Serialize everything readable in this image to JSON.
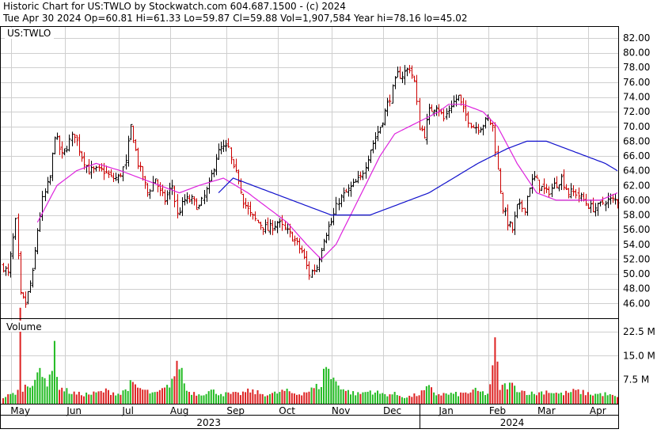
{
  "header": {
    "line1": "Historic Chart for US:TWLO by Stockwatch.com 604.687.1500 - (c) 2024",
    "line2": "Tue Apr 30 2024   Op=60.81   Hi=61.33   Lo=59.87   Cl=59.88   Vol=1,907,584   Year hi=78.16   lo=45.02"
  },
  "chart_data": {
    "type": "ohlc",
    "symbol_label": "US:TWLO",
    "volume_label": "Volume",
    "price_axis": {
      "ylim": [
        44.0,
        83.5
      ],
      "ticks": [
        46,
        48,
        50,
        52,
        54,
        56,
        58,
        60,
        62,
        64,
        66,
        68,
        70,
        72,
        74,
        76,
        78,
        80,
        82
      ],
      "tick_labels": [
        "46.00",
        "48.00",
        "50.00",
        "52.00",
        "54.00",
        "56.00",
        "58.00",
        "60.00",
        "62.00",
        "64.00",
        "66.00",
        "68.00",
        "70.00",
        "72.00",
        "74.00",
        "76.00",
        "78.00",
        "80.00",
        "82.00"
      ]
    },
    "volume_axis": {
      "ylim": [
        0,
        26.5
      ],
      "ticks": [
        7.5,
        15.0,
        22.5
      ],
      "tick_labels": [
        "7.5 M",
        "15.0 M",
        "22.5 M"
      ]
    },
    "x_axis": {
      "months": [
        {
          "label": "May",
          "index": 7
        },
        {
          "label": "Jun",
          "index": 29
        },
        {
          "label": "Jul",
          "index": 51
        },
        {
          "label": "Aug",
          "index": 72
        },
        {
          "label": "Sep",
          "index": 95
        },
        {
          "label": "Oct",
          "index": 116
        },
        {
          "label": "Nov",
          "index": 138
        },
        {
          "label": "Dec",
          "index": 159
        },
        {
          "label": "Jan",
          "index": 181
        },
        {
          "label": "Feb",
          "index": 202
        },
        {
          "label": "Mar",
          "index": 222
        },
        {
          "label": "Apr",
          "index": 243
        }
      ],
      "years": [
        {
          "label": "2023",
          "index": 84
        },
        {
          "label": "2024",
          "index": 208
        }
      ],
      "year_divider_index": 170
    },
    "price_keypoints": [
      [
        0,
        51
      ],
      [
        2,
        50
      ],
      [
        5,
        57
      ],
      [
        7,
        47
      ],
      [
        9,
        46
      ],
      [
        12,
        50
      ],
      [
        14,
        56
      ],
      [
        16,
        60
      ],
      [
        19,
        63
      ],
      [
        21,
        69
      ],
      [
        24,
        66
      ],
      [
        27,
        68
      ],
      [
        29,
        69
      ],
      [
        32,
        66
      ],
      [
        35,
        64
      ],
      [
        38,
        64
      ],
      [
        41,
        64
      ],
      [
        44,
        63
      ],
      [
        47,
        63
      ],
      [
        50,
        65
      ],
      [
        52,
        70
      ],
      [
        55,
        65
      ],
      [
        57,
        63
      ],
      [
        59,
        61
      ],
      [
        62,
        63
      ],
      [
        64,
        61
      ],
      [
        66,
        60
      ],
      [
        69,
        62
      ],
      [
        71,
        58
      ],
      [
        74,
        60
      ],
      [
        77,
        60
      ],
      [
        80,
        59
      ],
      [
        84,
        62
      ],
      [
        87,
        66
      ],
      [
        89,
        67
      ],
      [
        92,
        67
      ],
      [
        94,
        64
      ],
      [
        96,
        63
      ],
      [
        98,
        60
      ],
      [
        101,
        58
      ],
      [
        104,
        57
      ],
      [
        108,
        56
      ],
      [
        112,
        57
      ],
      [
        115,
        56
      ],
      [
        118,
        55
      ],
      [
        122,
        53
      ],
      [
        125,
        50
      ],
      [
        128,
        51
      ],
      [
        131,
        55
      ],
      [
        134,
        57
      ],
      [
        137,
        60
      ],
      [
        140,
        61
      ],
      [
        143,
        62
      ],
      [
        146,
        63
      ],
      [
        150,
        67
      ],
      [
        154,
        70
      ],
      [
        158,
        74
      ],
      [
        161,
        77
      ],
      [
        163,
        77
      ],
      [
        166,
        78
      ],
      [
        168,
        76
      ],
      [
        170,
        70
      ],
      [
        172,
        69
      ],
      [
        174,
        72
      ],
      [
        177,
        73
      ],
      [
        180,
        71
      ],
      [
        183,
        73
      ],
      [
        186,
        74
      ],
      [
        188,
        72
      ],
      [
        190,
        71
      ],
      [
        192,
        70
      ],
      [
        195,
        70
      ],
      [
        198,
        71
      ],
      [
        200,
        70
      ],
      [
        202,
        64
      ],
      [
        204,
        59
      ],
      [
        206,
        57
      ],
      [
        208,
        56
      ],
      [
        210,
        59
      ],
      [
        213,
        59
      ],
      [
        215,
        62
      ],
      [
        217,
        63
      ],
      [
        219,
        62
      ],
      [
        222,
        61
      ],
      [
        225,
        62
      ],
      [
        228,
        63
      ],
      [
        231,
        61
      ],
      [
        234,
        61
      ],
      [
        237,
        60
      ],
      [
        240,
        59
      ],
      [
        243,
        59
      ],
      [
        246,
        60
      ],
      [
        249,
        60
      ],
      [
        251,
        60
      ]
    ],
    "ma_short": [
      [
        14,
        57
      ],
      [
        22,
        62
      ],
      [
        30,
        64
      ],
      [
        38,
        65
      ],
      [
        48,
        64
      ],
      [
        56,
        63
      ],
      [
        64,
        62
      ],
      [
        72,
        61
      ],
      [
        80,
        62
      ],
      [
        90,
        63
      ],
      [
        100,
        61
      ],
      [
        108,
        59
      ],
      [
        116,
        57
      ],
      [
        124,
        54
      ],
      [
        130,
        52
      ],
      [
        136,
        54
      ],
      [
        142,
        58
      ],
      [
        148,
        62
      ],
      [
        154,
        66
      ],
      [
        160,
        69
      ],
      [
        166,
        70
      ],
      [
        172,
        71
      ],
      [
        178,
        72
      ],
      [
        182,
        73
      ],
      [
        188,
        73
      ],
      [
        196,
        72
      ],
      [
        202,
        70
      ],
      [
        210,
        65
      ],
      [
        218,
        61
      ],
      [
        226,
        60
      ],
      [
        236,
        60
      ],
      [
        244,
        60
      ],
      [
        251,
        61
      ]
    ],
    "ma_long": [
      [
        88,
        61
      ],
      [
        94,
        63
      ],
      [
        102,
        62
      ],
      [
        110,
        61
      ],
      [
        118,
        60
      ],
      [
        126,
        59
      ],
      [
        134,
        58
      ],
      [
        142,
        58
      ],
      [
        150,
        58
      ],
      [
        158,
        59
      ],
      [
        166,
        60
      ],
      [
        174,
        61
      ],
      [
        184,
        63
      ],
      [
        194,
        65
      ],
      [
        206,
        67
      ],
      [
        214,
        68
      ],
      [
        222,
        68
      ],
      [
        230,
        67
      ],
      [
        238,
        66
      ],
      [
        246,
        65
      ],
      [
        251,
        64
      ]
    ],
    "volume_keypoints": [
      [
        0,
        2
      ],
      [
        4,
        3
      ],
      [
        6,
        4
      ],
      [
        7,
        26
      ],
      [
        8,
        5
      ],
      [
        11,
        6
      ],
      [
        14,
        10
      ],
      [
        16,
        8
      ],
      [
        18,
        7
      ],
      [
        20,
        12
      ],
      [
        21,
        16
      ],
      [
        23,
        5
      ],
      [
        26,
        4
      ],
      [
        30,
        3
      ],
      [
        36,
        3
      ],
      [
        42,
        4
      ],
      [
        48,
        3
      ],
      [
        52,
        6
      ],
      [
        55,
        5
      ],
      [
        58,
        4
      ],
      [
        62,
        3
      ],
      [
        67,
        5
      ],
      [
        70,
        9
      ],
      [
        72,
        13
      ],
      [
        75,
        4
      ],
      [
        80,
        3
      ],
      [
        85,
        4
      ],
      [
        90,
        3
      ],
      [
        96,
        3
      ],
      [
        101,
        4
      ],
      [
        106,
        3
      ],
      [
        110,
        3
      ],
      [
        115,
        4
      ],
      [
        120,
        3
      ],
      [
        125,
        4
      ],
      [
        130,
        6
      ],
      [
        132,
        13
      ],
      [
        134,
        8
      ],
      [
        136,
        7
      ],
      [
        140,
        4
      ],
      [
        145,
        3
      ],
      [
        150,
        4
      ],
      [
        155,
        3
      ],
      [
        160,
        3
      ],
      [
        165,
        2
      ],
      [
        170,
        3
      ],
      [
        174,
        5
      ],
      [
        177,
        3
      ],
      [
        182,
        3
      ],
      [
        187,
        3
      ],
      [
        193,
        4
      ],
      [
        198,
        3
      ],
      [
        200,
        10
      ],
      [
        201,
        19
      ],
      [
        202,
        11
      ],
      [
        203,
        5
      ],
      [
        207,
        6
      ],
      [
        212,
        4
      ],
      [
        217,
        3
      ],
      [
        222,
        4
      ],
      [
        228,
        3
      ],
      [
        234,
        4
      ],
      [
        240,
        3
      ],
      [
        246,
        3
      ],
      [
        251,
        2
      ]
    ],
    "colors": {
      "up_bar": "#000000",
      "down_bar": "#cc0000",
      "volume_up": "#22bb22",
      "volume_down": "#dd2222",
      "ma_short": "#dd22dd",
      "ma_long": "#1111cc",
      "grid": "#cfcfcf"
    }
  }
}
